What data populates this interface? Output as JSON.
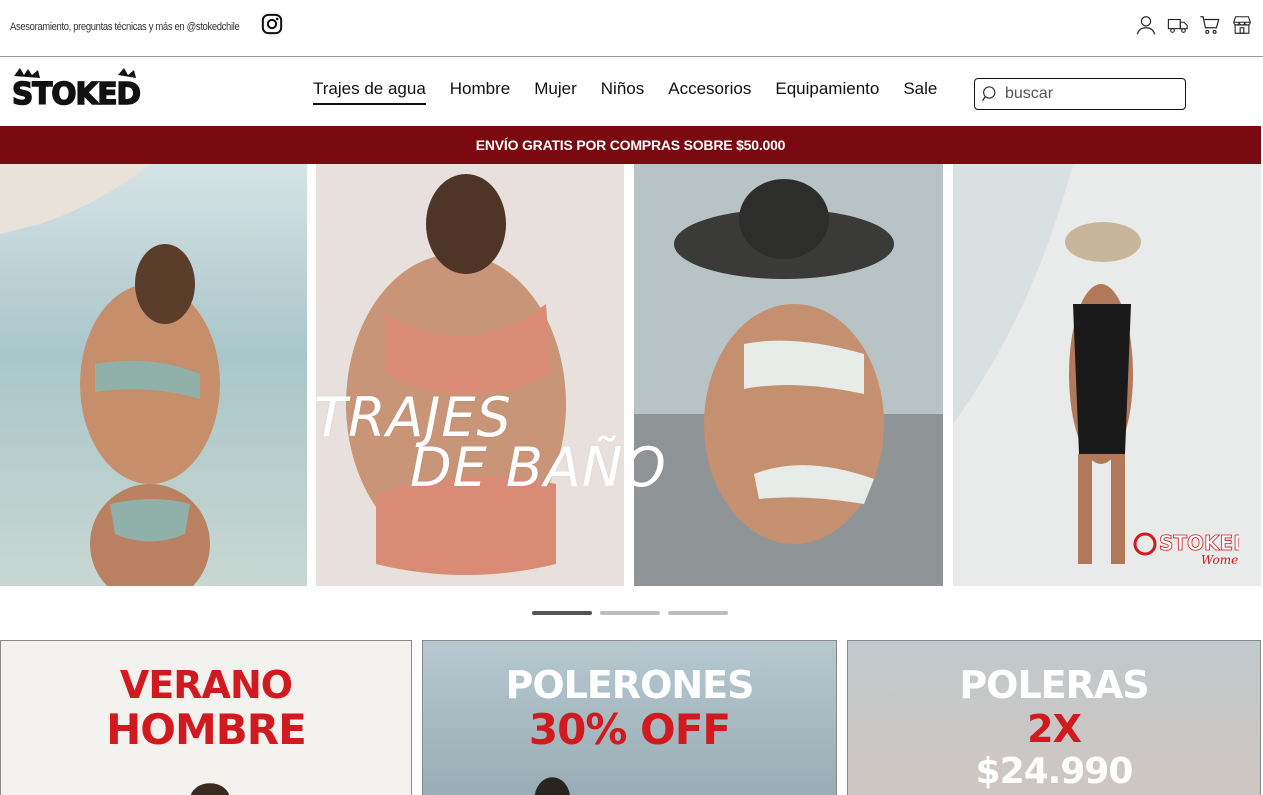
{
  "topbar": {
    "text": "Asesoramiento, preguntas técnicas y más en @stokedchile",
    "icons": [
      "instagram-icon",
      "user-icon",
      "truck-icon",
      "cart-icon",
      "store-icon"
    ]
  },
  "brand": {
    "logo_text": "STOKED"
  },
  "nav": {
    "items": [
      {
        "label": "Trajes de agua",
        "active": true
      },
      {
        "label": "Hombre"
      },
      {
        "label": "Mujer"
      },
      {
        "label": "Niños"
      },
      {
        "label": "Accesorios"
      },
      {
        "label": "Equipamiento"
      },
      {
        "label": "Sale"
      }
    ],
    "search_placeholder": "buscar"
  },
  "promo": {
    "text": "ENVÍO GRATIS POR COMPRAS SOBRE $50.000",
    "color": "#7a0a0f"
  },
  "hero": {
    "title_line1": "TRAJES",
    "title_line2": "DE BAÑO",
    "badge_text": "STOKED",
    "badge_sub": "Women",
    "slides": 3,
    "active_slide": 1
  },
  "tiles": [
    {
      "line1": "VERANO",
      "line2": "HOMBRE",
      "text_color": "#d11a1f",
      "line2_color": "#d11a1f"
    },
    {
      "line1": "POLERONES",
      "line2": "30% OFF",
      "text_color": "#ffffff",
      "line2_color": "#d11a1f"
    },
    {
      "line1": "POLERAS",
      "line2": "2X",
      "line3": "$24.990",
      "text_color": "#ffffff",
      "line2_color": "#d11a1f"
    }
  ],
  "colors": {
    "accent": "#7a0a0f",
    "brand_red": "#d11a1f"
  }
}
